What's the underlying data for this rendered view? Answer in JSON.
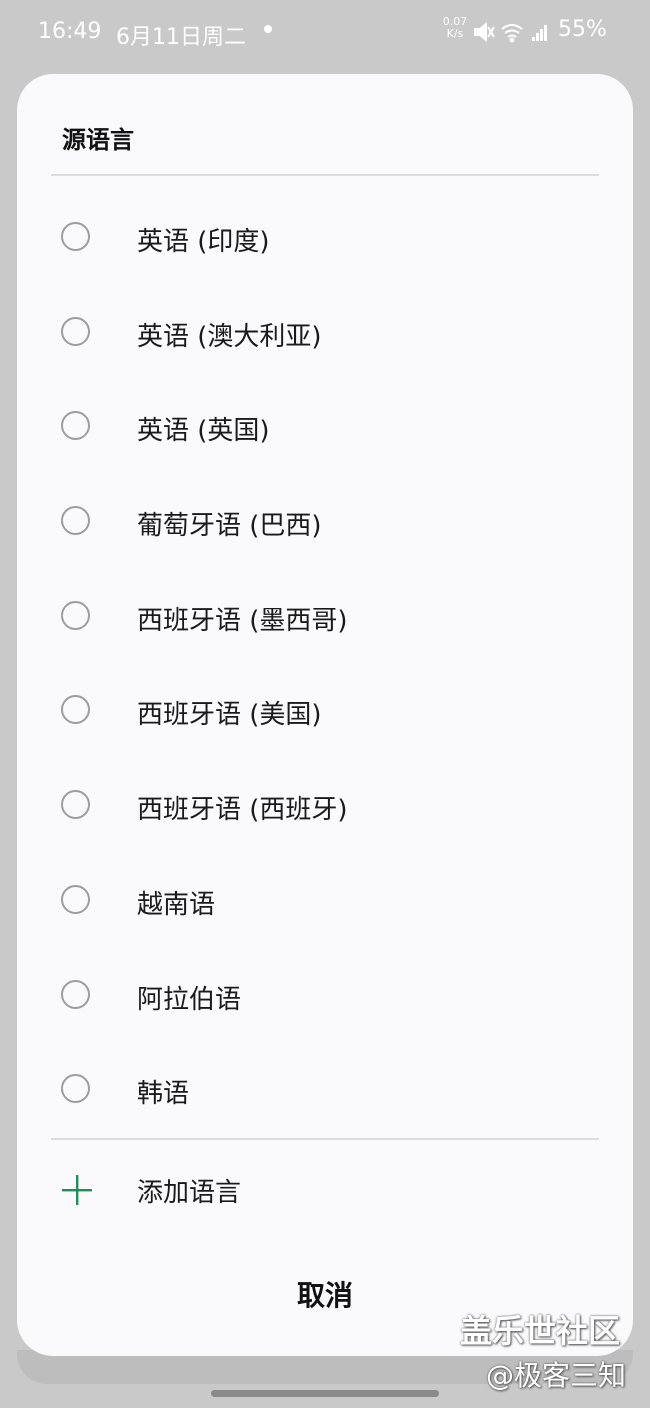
{
  "status_bar": {
    "time": "16:49",
    "date": "6月11日周二",
    "net_speed_value": "0.07",
    "net_speed_unit": "K/s",
    "battery": "55%",
    "icons": [
      "mute-icon",
      "wifi-icon",
      "signal-icon"
    ]
  },
  "dialog": {
    "title": "源语言",
    "options": [
      {
        "label": "英语 (印度)",
        "selected": false
      },
      {
        "label": "英语 (澳大利亚)",
        "selected": false
      },
      {
        "label": "英语 (英国)",
        "selected": false
      },
      {
        "label": "葡萄牙语 (巴西)",
        "selected": false
      },
      {
        "label": "西班牙语 (墨西哥)",
        "selected": false
      },
      {
        "label": "西班牙语 (美国)",
        "selected": false
      },
      {
        "label": "西班牙语 (西班牙)",
        "selected": false
      },
      {
        "label": "越南语",
        "selected": false
      },
      {
        "label": "阿拉伯语",
        "selected": false
      },
      {
        "label": "韩语",
        "selected": false
      }
    ],
    "add_label": "添加语言",
    "cancel_label": "取消"
  },
  "watermark": {
    "line1": "盖乐世社区",
    "line2": "@极客三知"
  },
  "colors": {
    "accent": "#1e8e5a",
    "radio_border": "#9d9d9d",
    "backdrop": "#c9c9c9"
  }
}
